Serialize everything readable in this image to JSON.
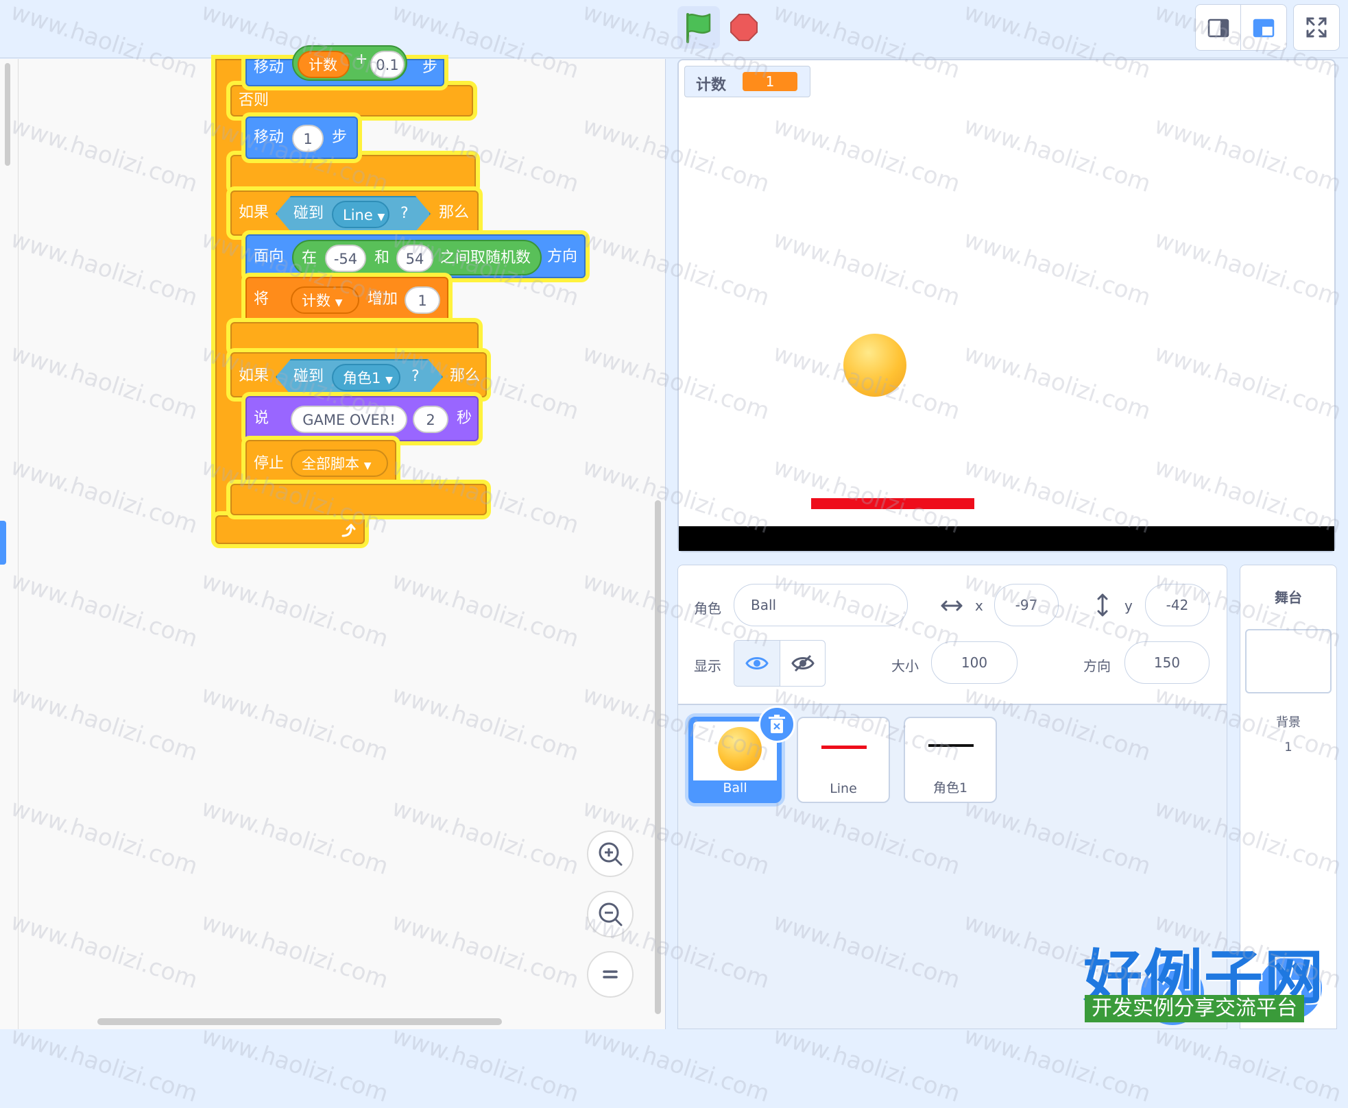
{
  "toolbar": {
    "green_flag": "green-flag-icon",
    "stop": "stop-icon",
    "layout_small": "small-stage-icon",
    "layout_normal": "normal-stage-icon",
    "fullscreen": "fullscreen-icon"
  },
  "code": {
    "move_top": {
      "label": "移动",
      "var": "计数",
      "op": "+",
      "num": "0.1",
      "unit": "步"
    },
    "else_label": "否则",
    "move_one": {
      "label": "移动",
      "value": "1",
      "unit": "步"
    },
    "if_line": {
      "if": "如果",
      "touching": "碰到",
      "target": "Line",
      "q": "?",
      "then": "那么"
    },
    "point_dir": {
      "label": "面向",
      "in": "在",
      "a": "-54",
      "and": "和",
      "b": "54",
      "random": "之间取随机数",
      "dir": "方向"
    },
    "change_var": {
      "label": "将",
      "var": "计数",
      "by": "增加",
      "value": "1"
    },
    "if_sprite": {
      "if": "如果",
      "touching": "碰到",
      "target": "角色1",
      "q": "?",
      "then": "那么"
    },
    "say": {
      "label": "说",
      "text": "GAME OVER!",
      "secs": "2",
      "unit": "秒"
    },
    "stop": {
      "label": "停止",
      "option": "全部脚本"
    }
  },
  "monitor": {
    "name": "计数",
    "value": "1"
  },
  "sprite_info": {
    "sprite_label": "角色",
    "sprite_name": "Ball",
    "x_label": "x",
    "x_value": "-97",
    "y_label": "y",
    "y_value": "-42",
    "show_label": "显示",
    "size_label": "大小",
    "size_value": "100",
    "direction_label": "方向",
    "direction_value": "150"
  },
  "sprites": [
    {
      "name": "Ball",
      "selected": true
    },
    {
      "name": "Line",
      "selected": false
    },
    {
      "name": "角色1",
      "selected": false
    }
  ],
  "stage_panel": {
    "title": "舞台",
    "backdrop_label": "背景",
    "backdrop_count": "1"
  },
  "watermark": {
    "text": "www.haolizi.com",
    "logo_title": "好例子网",
    "logo_sub": "开发实例分享交流平台"
  },
  "colors": {
    "accent": "#4c97ff",
    "control": "#ffab19",
    "motion": "#4c97ff",
    "variables": "#ff8c1a",
    "looks": "#9966ff",
    "sensing": "#5cb1d6",
    "operators": "#59c059"
  }
}
